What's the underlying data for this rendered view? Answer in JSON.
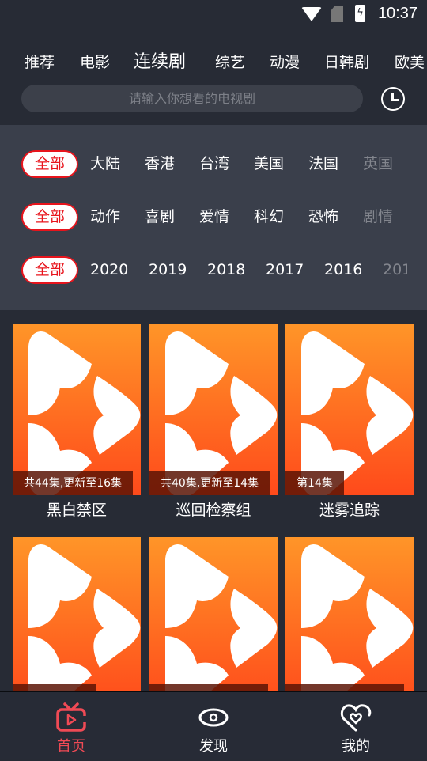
{
  "status_bar": {
    "time": "10:37",
    "icons": [
      "wifi-icon",
      "no-sim-icon",
      "battery-charging-icon"
    ]
  },
  "tabs": [
    {
      "label": "推荐"
    },
    {
      "label": "电影"
    },
    {
      "label": "连续剧",
      "active": true
    },
    {
      "label": "综艺"
    },
    {
      "label": "动漫"
    },
    {
      "label": "日韩剧"
    },
    {
      "label": "欧美"
    }
  ],
  "search": {
    "placeholder": "请输入你想看的电视剧",
    "history_icon": "clock-icon"
  },
  "filters": {
    "region": {
      "selected": "全部",
      "options": [
        "大陆",
        "香港",
        "台湾",
        "美国",
        "法国",
        "英国"
      ]
    },
    "genre": {
      "selected": "全部",
      "options": [
        "动作",
        "喜剧",
        "爱情",
        "科幻",
        "恐怖",
        "剧情"
      ]
    },
    "year": {
      "selected": "全部",
      "options": [
        "2020",
        "2019",
        "2018",
        "2017",
        "2016",
        "201"
      ]
    }
  },
  "cards": [
    {
      "title": "黑白禁区",
      "badge": "共44集,更新至16集"
    },
    {
      "title": "巡回检察组",
      "badge": "共40集,更新至14集"
    },
    {
      "title": "迷雾追踪",
      "badge": "第14集"
    },
    {
      "title": "",
      "badge": ""
    },
    {
      "title": "",
      "badge": ""
    },
    {
      "title": "",
      "badge": ""
    }
  ],
  "bottom_nav": [
    {
      "label": "首页",
      "icon": "tv-icon",
      "active": true
    },
    {
      "label": "发现",
      "icon": "eye-icon"
    },
    {
      "label": "我的",
      "icon": "heart-icon"
    }
  ],
  "colors": {
    "accent": "#e8141c",
    "nav_active": "#f04a55",
    "background": "#272b35",
    "filter_panel": "#3a3f4b"
  }
}
